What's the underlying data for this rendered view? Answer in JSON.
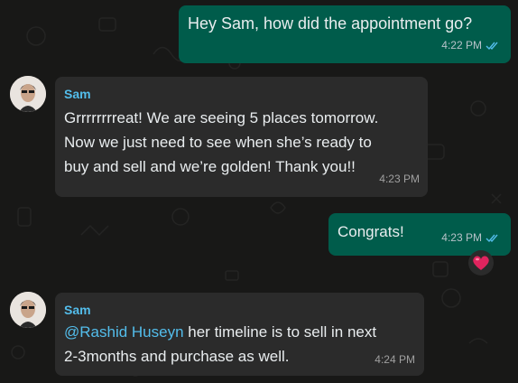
{
  "colors": {
    "background": "#181817",
    "outgoing_bubble": "#005c4b",
    "incoming_bubble": "#2b2b2b",
    "sender_name": "#53bdeb",
    "read_ticks": "#53bdeb",
    "reaction_heart": "#e0245e"
  },
  "messages": [
    {
      "direction": "outgoing",
      "text": "Hey Sam, how did the appointment go?",
      "time": "4:22 PM",
      "status_icon": "double-check-read-icon"
    },
    {
      "direction": "incoming",
      "sender": "Sam",
      "avatar_icon": "contact-avatar",
      "text": "Grrrrrrrreat! We are seeing 5 places tomorrow.\nNow we just need to see when she’s ready to\nbuy and sell and we’re golden! Thank you!!",
      "time": "4:23 PM"
    },
    {
      "direction": "outgoing",
      "text": "Congrats!",
      "time": "4:23 PM",
      "status_icon": "double-check-read-icon",
      "reaction": "heart-emoji-icon"
    },
    {
      "direction": "incoming",
      "sender": "Sam",
      "avatar_icon": "contact-avatar",
      "mention": "@Rashid Huseyn",
      "text": " her timeline is to sell in next\n2-3months and purchase as well.",
      "time": "4:24 PM"
    }
  ]
}
